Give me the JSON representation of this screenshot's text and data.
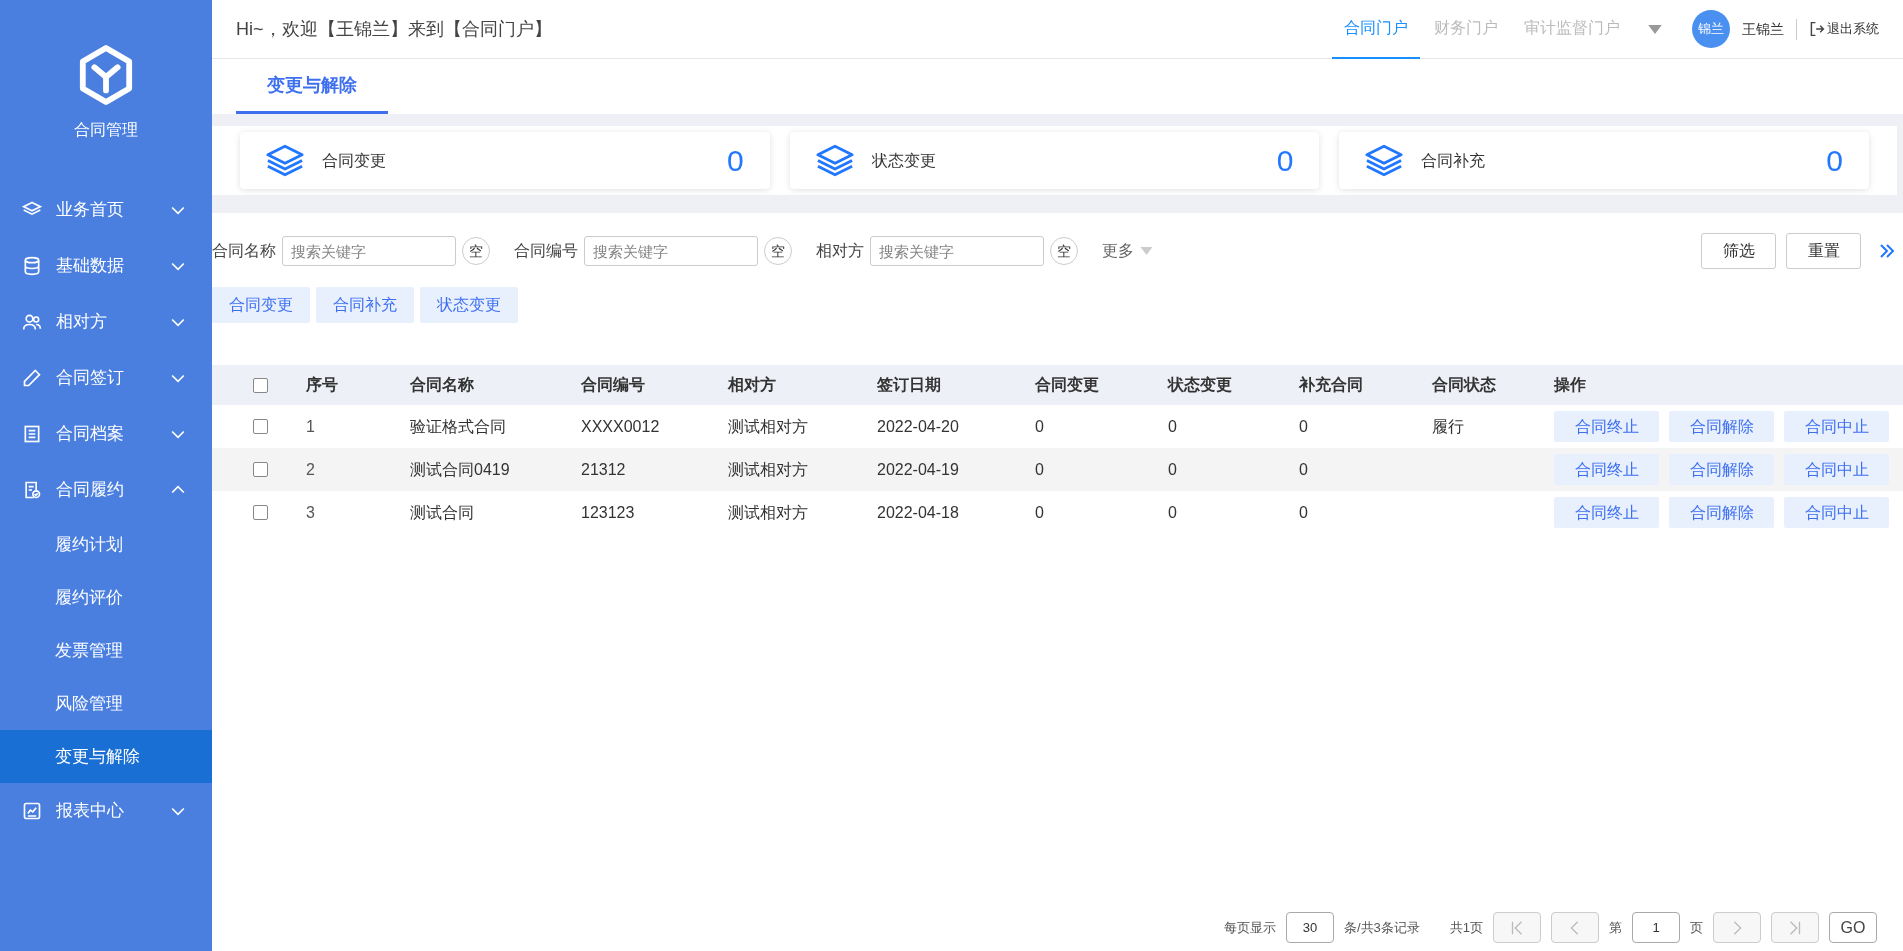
{
  "sidebar": {
    "logo_title": "合同管理",
    "items": [
      {
        "label": "业务首页",
        "expanded": false
      },
      {
        "label": "基础数据",
        "expanded": false
      },
      {
        "label": "相对方",
        "expanded": false
      },
      {
        "label": "合同签订",
        "expanded": false
      },
      {
        "label": "合同档案",
        "expanded": false
      },
      {
        "label": "合同履约",
        "expanded": true,
        "children": [
          {
            "label": "履约计划",
            "selected": false
          },
          {
            "label": "履约评价",
            "selected": false
          },
          {
            "label": "发票管理",
            "selected": false
          },
          {
            "label": "风险管理",
            "selected": false
          },
          {
            "label": "变更与解除",
            "selected": true
          }
        ]
      },
      {
        "label": "报表中心",
        "expanded": false
      }
    ]
  },
  "header": {
    "greeting": "Hi~，欢迎【王锦兰】来到【合同门户】",
    "portals": [
      {
        "label": "合同门户",
        "selected": true
      },
      {
        "label": "财务门户",
        "selected": false
      },
      {
        "label": "审计监督门户",
        "selected": false
      }
    ],
    "user": {
      "avatar": "锦兰",
      "name": "王锦兰"
    },
    "logout": "退出系统"
  },
  "page_tabs": [
    {
      "label": "变更与解除",
      "selected": true
    }
  ],
  "stats": [
    {
      "label": "合同变更",
      "value": "0"
    },
    {
      "label": "状态变更",
      "value": "0"
    },
    {
      "label": "合同补充",
      "value": "0"
    }
  ],
  "filters": [
    {
      "label": "合同名称",
      "placeholder": "搜索关键字",
      "clear": "空"
    },
    {
      "label": "合同编号",
      "placeholder": "搜索关键字",
      "clear": "空"
    },
    {
      "label": "相对方",
      "placeholder": "搜索关键字",
      "clear": "空"
    }
  ],
  "more": "更多",
  "filter_buttons": [
    "筛选",
    "重置"
  ],
  "quick_tags": [
    "合同变更",
    "合同补充",
    "状态变更"
  ],
  "table": {
    "all_checked": false,
    "columns": [
      "序号",
      "合同名称",
      "合同编号",
      "相对方",
      "签订日期",
      "合同变更",
      "状态变更",
      "补充合同",
      "合同状态",
      "操作"
    ],
    "rows": [
      {
        "checked": false,
        "cells": [
          "1",
          "验证格式合同",
          "XXXX0012",
          "测试相对方",
          "2022-04-20",
          "0",
          "0",
          "0",
          "履行"
        ],
        "actions": [
          "合同终止",
          "合同解除",
          "合同中止"
        ]
      },
      {
        "checked": false,
        "cells": [
          "2",
          "测试合同0419",
          "21312",
          "测试相对方",
          "2022-04-19",
          "0",
          "0",
          "0",
          ""
        ],
        "actions": [
          "合同终止",
          "合同解除",
          "合同中止"
        ]
      },
      {
        "checked": false,
        "cells": [
          "3",
          "测试合同",
          "123123",
          "测试相对方",
          "2022-04-18",
          "0",
          "0",
          "0",
          ""
        ],
        "actions": [
          "合同终止",
          "合同解除",
          "合同中止"
        ]
      }
    ]
  },
  "pagination": {
    "per_page_label": "每页显示",
    "per_page": "30",
    "summary": "条/共3条记录",
    "total_pages": "共1页",
    "page_prefix": "第",
    "page": "1",
    "page_suffix": "页",
    "go": "GO"
  }
}
